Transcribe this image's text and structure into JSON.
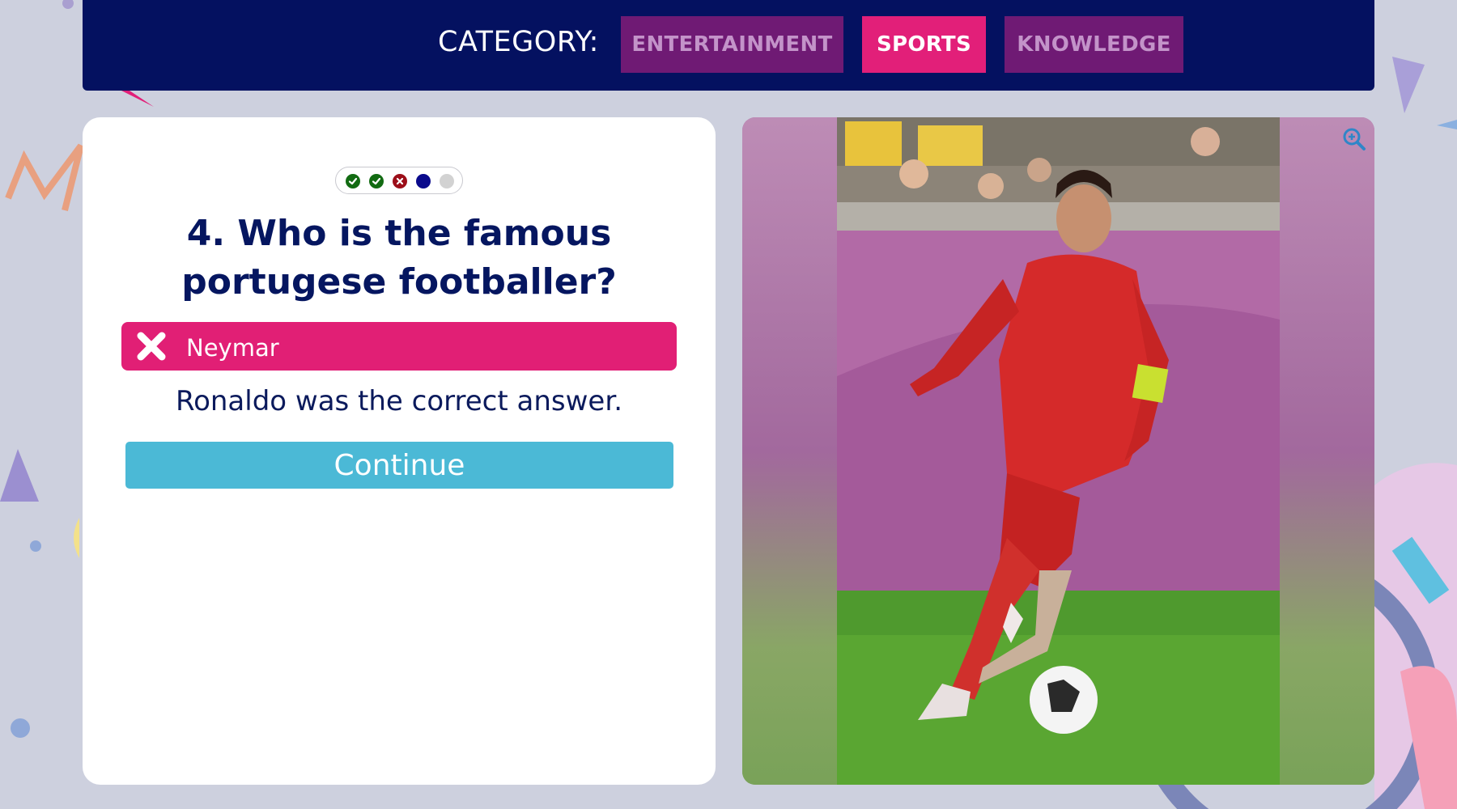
{
  "category": {
    "label": "CATEGORY:",
    "options": [
      {
        "label": "ENTERTAINMENT",
        "active": false
      },
      {
        "label": "SPORTS",
        "active": true
      },
      {
        "label": "KNOWLEDGE",
        "active": false
      }
    ]
  },
  "progress": [
    {
      "state": "correct",
      "icon": "check-icon",
      "color": "#126b12"
    },
    {
      "state": "correct",
      "icon": "check-icon",
      "color": "#126b12"
    },
    {
      "state": "wrong",
      "icon": "x-icon",
      "color": "#9c0e19"
    },
    {
      "state": "current",
      "color": "#0a0a8c"
    },
    {
      "state": "upcoming",
      "color": "#d2d2d2"
    }
  ],
  "question": {
    "text": "4. Who is the famous portugese footballer?"
  },
  "selected_answer": {
    "text": "Neymar",
    "status": "wrong",
    "icon": "x-icon"
  },
  "feedback": {
    "text": "Ronaldo was the correct answer."
  },
  "continue_button": {
    "label": "Continue"
  },
  "image": {
    "subject": "footballer in red Portugal kit, number 7, dribbling a ball",
    "zoom_icon": "zoom-in-icon"
  },
  "colors": {
    "navy": "#041160",
    "pink": "#e21f79",
    "purple": "#6f1a74",
    "cyan": "#4bb9d6",
    "background": "#cdd0de"
  }
}
